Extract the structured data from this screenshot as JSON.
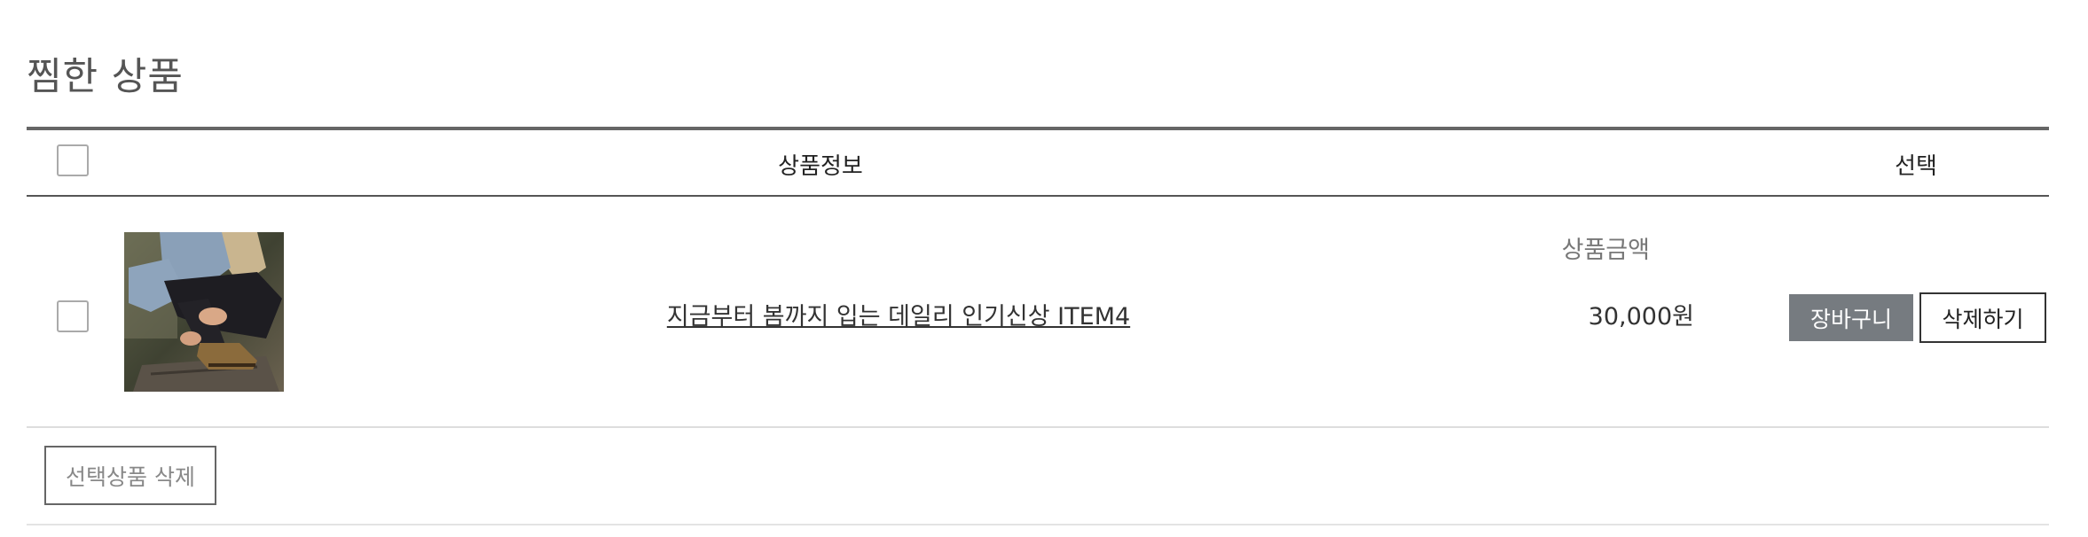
{
  "wishlist": {
    "title": "찜한 상품",
    "columns": {
      "product_info": "상품정보",
      "price": "상품금액",
      "select": "선택"
    },
    "items": [
      {
        "name": "지금부터 봄까지 입는 데일리 인기신상 ITEM4",
        "price": "30,000원",
        "cart_button": "장바구니",
        "delete_button": "삭제하기"
      }
    ],
    "delete_selected_button": "선택상품 삭제"
  }
}
